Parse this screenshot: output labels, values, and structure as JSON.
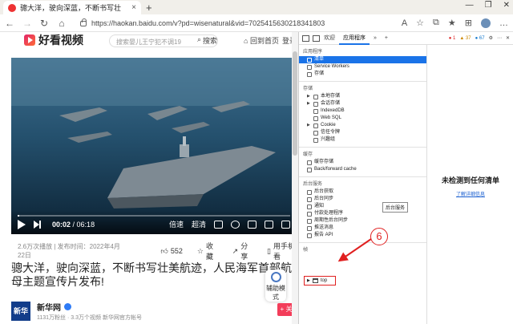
{
  "browser": {
    "tab_title": "骢大洋，驶向深蓝，不断书写壮",
    "tab_close": "×",
    "new_tab": "+",
    "window_buttons": [
      "—",
      "❐",
      "✕"
    ],
    "nav": {
      "back": "←",
      "forward": "→",
      "reload": "↻",
      "home": "⌂"
    },
    "url": "https://haokan.baidu.com/v?pd=wisenatural&vid=7025415630218341803",
    "toolbar_icons": [
      "A",
      "☆",
      "⧉",
      "★",
      "⊞",
      "…"
    ]
  },
  "site": {
    "logo": "好看视频",
    "search_placeholder": "搜索晏儿王宁犯不调19",
    "search_button": "搜索",
    "home_link": "回到首页",
    "login_link": "登录"
  },
  "player": {
    "current_time": "00:02",
    "duration": "/ 06:18",
    "progress": 0.005,
    "speed_label": "倍速",
    "quality_label": "超清"
  },
  "video": {
    "views_date": "2.6万次播放 | 发布时间：2022年4月22日",
    "likes": "552",
    "favorite": "收藏",
    "share": "分享",
    "mobile": "用手机看",
    "title": "骢大洋，驶向深蓝，不断书写壮美航迹，人民海军首部航母主题宣传片发布!",
    "assist_mode": "辅助模式"
  },
  "author": {
    "logo_text": "新华",
    "name": "新华网",
    "stats": "1131万粉丝 · 3.3万个视频    新华网官方帐号",
    "follow": "+ 关注"
  },
  "devtools": {
    "tabs": [
      "欢迎",
      "应用程序",
      "»",
      "+"
    ],
    "badges": {
      "errors": "● 1",
      "warnings": "▲ 37",
      "info": "● 67"
    },
    "sections": {
      "app": "应用程序",
      "storage": "存储",
      "cache": "缓存",
      "background": "后台服务",
      "frames": "帧"
    },
    "app_items": [
      "清单",
      "Service Workers",
      "存储"
    ],
    "storage_items": [
      "本地存储",
      "会话存储",
      "IndexedDB",
      "Web SQL",
      "Cookie",
      "信任令牌",
      "兴趣组"
    ],
    "cache_items": [
      "缓存存储",
      "Back/forward cache"
    ],
    "background_items": [
      "后台获取",
      "后台同步",
      "通知",
      "付款处理程序",
      "周期性后台同步",
      "推送消息",
      "报告 API"
    ],
    "tooltip": "后台服务",
    "frame_item": "top",
    "empty_message": "未检测到任何清单",
    "learn_more": "了解详细信息"
  },
  "annotation": {
    "number": "6"
  },
  "colors": {
    "accent": "#1a73e8",
    "annotation": "#e02020",
    "follow": "#f33d5a"
  }
}
